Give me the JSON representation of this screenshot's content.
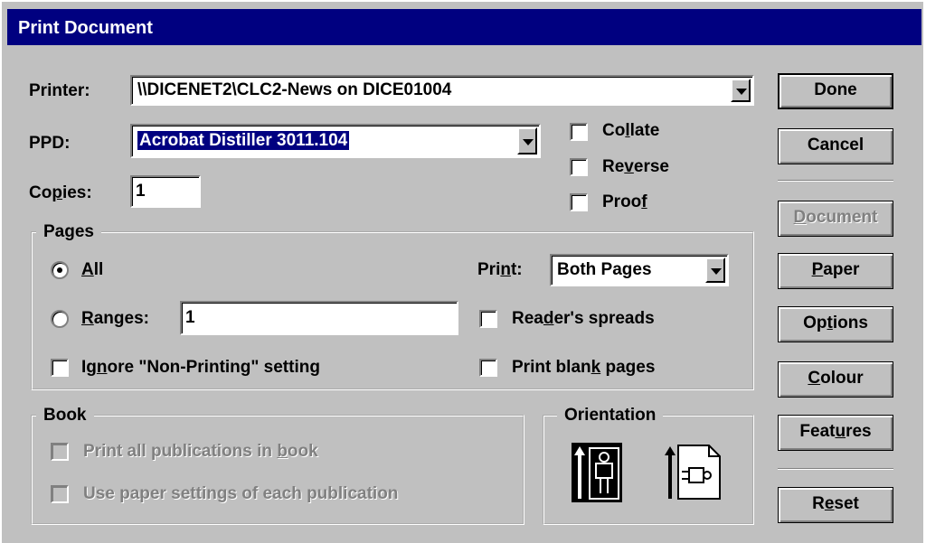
{
  "window": {
    "title": "Print Document"
  },
  "printer": {
    "label": "Printer:",
    "value": "\\\\DICENET2\\CLC2-News on DICE01004"
  },
  "ppd": {
    "label": "PPD:",
    "value": "Acrobat Distiller 3011.104"
  },
  "copies": {
    "label_pre": "Co",
    "label_ul": "p",
    "label_post": "ies:",
    "value": "1"
  },
  "options": {
    "collate": {
      "pre": "Co",
      "ul": "l",
      "post": "late",
      "checked": false
    },
    "reverse": {
      "pre": "Re",
      "ul": "v",
      "post": "erse",
      "checked": false
    },
    "proof": {
      "pre": "Proo",
      "ul": "f",
      "post": "",
      "checked": false
    }
  },
  "pages": {
    "legend": "Pages",
    "all": {
      "pre": "",
      "ul": "A",
      "post": "ll",
      "selected": true
    },
    "ranges": {
      "pre": "",
      "ul": "R",
      "post": "anges:",
      "value": "1",
      "selected": false
    },
    "ignore": {
      "pre": "Ig",
      "ul": "n",
      "post": "ore \"Non-Printing\" setting",
      "checked": false
    },
    "print": {
      "pre": "Pri",
      "ul": "n",
      "post": "t:",
      "value": "Both Pages"
    },
    "readers": {
      "pre": "Rea",
      "ul": "d",
      "post": "er's spreads",
      "checked": false
    },
    "blank": {
      "pre": "Print blan",
      "ul": "k",
      "post": " pages",
      "checked": false
    }
  },
  "book": {
    "legend": "Book",
    "all_pubs": {
      "pre": "Print all publications in ",
      "ul": "b",
      "post": "ook"
    },
    "paper_settings": {
      "pre": "Use paper settin",
      "ul": "g",
      "post": "s of each publication"
    }
  },
  "orientation": {
    "legend": "Orientation",
    "portrait": "portrait-orientation-icon",
    "landscape": "landscape-orientation-icon"
  },
  "buttons": {
    "done": "Done",
    "cancel": "Cancel",
    "document": {
      "pre": "",
      "ul": "D",
      "post": "ocument"
    },
    "paper": {
      "pre": "",
      "ul": "P",
      "post": "aper"
    },
    "options": {
      "pre": "Op",
      "ul": "t",
      "post": "ions"
    },
    "colour": {
      "pre": "",
      "ul": "C",
      "post": "olour"
    },
    "features": {
      "pre": "Feat",
      "ul": "u",
      "post": "res"
    },
    "reset": {
      "pre": "R",
      "ul": "e",
      "post": "set"
    }
  }
}
